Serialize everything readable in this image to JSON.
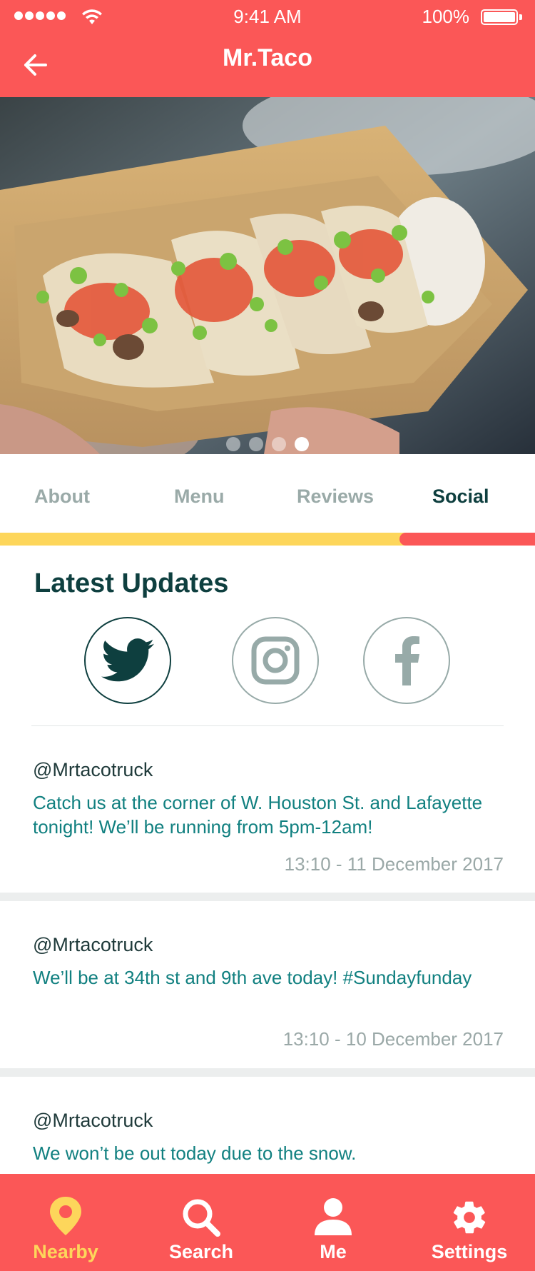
{
  "status_bar": {
    "time": "9:41 AM",
    "battery": "100%"
  },
  "header": {
    "title": "Mr.Taco",
    "back_icon": "arrow-left-icon"
  },
  "hero": {
    "description_icon": "tacos-photo",
    "carousel_total": 4,
    "carousel_active": 4
  },
  "tabs": [
    {
      "label": "About",
      "active": false
    },
    {
      "label": "Menu",
      "active": false
    },
    {
      "label": "Reviews",
      "active": false
    },
    {
      "label": "Social",
      "active": true
    }
  ],
  "section": {
    "title": "Latest Updates"
  },
  "social_networks": [
    {
      "icon": "twitter-icon",
      "active": true
    },
    {
      "icon": "instagram-icon",
      "active": false
    },
    {
      "icon": "facebook-icon",
      "active": false
    }
  ],
  "posts": [
    {
      "handle": "@Mrtacotruck",
      "text": "Catch us at the corner of W. Houston St. and Lafayette tonight! We’ll be running from 5pm-12am!",
      "time": "13:10 - 11 December 2017"
    },
    {
      "handle": "@Mrtacotruck",
      "text": "We’ll be at 34th st and 9th ave today! #Sundayfunday",
      "time": "13:10 - 10 December 2017"
    },
    {
      "handle": "@Mrtacotruck",
      "text": "We won’t be out today due to the snow.",
      "time": ""
    }
  ],
  "bottom_nav": [
    {
      "label": "Nearby",
      "icon": "map-pin-icon",
      "active": true
    },
    {
      "label": "Search",
      "icon": "search-icon",
      "active": false
    },
    {
      "label": "Me",
      "icon": "user-icon",
      "active": false
    },
    {
      "label": "Settings",
      "icon": "gear-icon",
      "active": false
    }
  ],
  "colors": {
    "primary": "#fb5757",
    "accent": "#fdd65b",
    "dark_teal": "#0e3f3f",
    "teal_text": "#118080",
    "muted": "#9aaaa8"
  }
}
